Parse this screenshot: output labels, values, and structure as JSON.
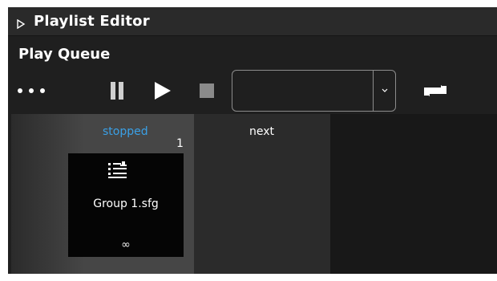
{
  "header": {
    "title": "Playlist Editor"
  },
  "section": {
    "title": "Play Queue"
  },
  "toolbar": {
    "dropdown_value": ""
  },
  "queue": {
    "status": "stopped",
    "index": "1",
    "next_label": "next",
    "item": {
      "name": "Group 1.sfg",
      "loop_symbol": "∞"
    }
  },
  "colors": {
    "accent": "#3aa0e6",
    "panel_dark": "#1f1f1f",
    "header_bg": "#2a2a2a",
    "icon_fill": "#ffffff",
    "stop_fill": "#8a8a8a"
  },
  "icons": {
    "header_expander": "triangle-right-icon",
    "more": "more-dots-icon",
    "pause": "pause-icon",
    "play": "play-icon",
    "stop": "stop-icon",
    "dropdown": "chevron-down-icon",
    "repeat": "repeat-icon",
    "playlist": "playlist-icon"
  }
}
